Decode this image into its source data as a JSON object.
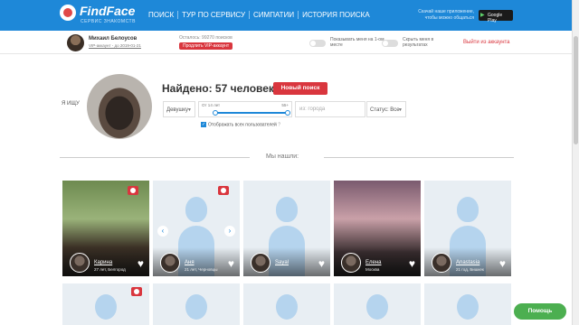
{
  "header": {
    "brand": "FindFace",
    "brand_sub": "СЕРВИС ЗНАКОМСТВ",
    "nav": [
      "ПОИСК",
      "ТУР ПО СЕРВИСУ",
      "СИМПАТИИ",
      "ИСТОРИЯ ПОИСКА"
    ],
    "promo": "Скачай наше приложение, чтобы можно общаться",
    "gplay": "Google Play"
  },
  "userbar": {
    "name": "Михаил Белоусов",
    "vip": "VIP-аккаунт - до 2019-01-21",
    "remain": "Осталось: 99270 поисков",
    "extend_vip": "Продлить VIP-аккаунт",
    "toggle1": "Показывать меня на 1-ом месте",
    "toggle2": "Скрыть меня в результатах",
    "logout": "Выйти из аккаунта"
  },
  "search": {
    "iam": "Я ИЩУ",
    "found": "Найдено: 57 человек",
    "new_search": "Новый поиск",
    "gender": "Девушку",
    "age_from": "От 14 лет",
    "age_to": "55+",
    "age_range_fill": [
      0,
      1
    ],
    "city_placeholder": "из: города",
    "status": "Статус: Все",
    "show_all": "Отображать всех пользователей",
    "we_found": "Мы нашли:"
  },
  "cards": [
    {
      "name": "Карина",
      "meta": "27 лет, Белгород",
      "photo": true,
      "camera": true
    },
    {
      "name": "Аня",
      "meta": "21 лет, Черновцы",
      "photo": false,
      "camera": true
    },
    {
      "name": "Sayal",
      "meta": "",
      "photo": false,
      "camera": false
    },
    {
      "name": "Елена",
      "meta": "Москва",
      "photo": true,
      "camera": false
    },
    {
      "name": "Anastasia",
      "meta": "21 год, Бишкек",
      "photo": false,
      "camera": false
    }
  ],
  "help_label": "Помощь",
  "colors": {
    "primary": "#1e88d8",
    "accent": "#d9363e",
    "help": "#4caf50"
  }
}
